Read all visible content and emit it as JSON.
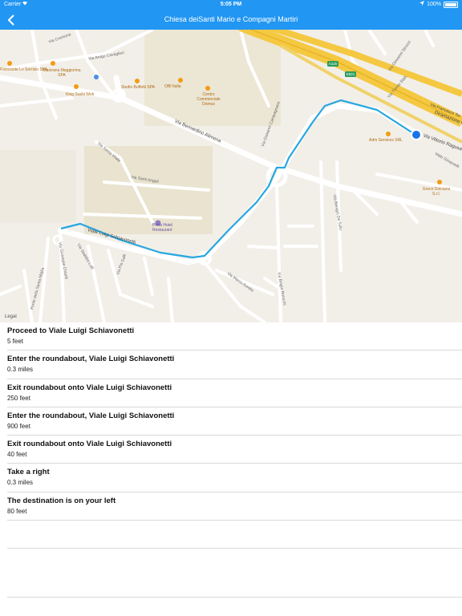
{
  "status_bar": {
    "carrier": "Carrier",
    "time": "5:05 PM",
    "battery": "100%"
  },
  "nav": {
    "title": "Chiesa deiSanti Mario e Compagni Martiri",
    "back_icon": "chevron-left-icon"
  },
  "map": {
    "legal": "Legal",
    "places": {
      "ristorante": "Ristorante Lo Sorrisio SPA",
      "maiorana": "Maiorana Maggiorina SPA",
      "studio": "Studio Buffetti SPA",
      "obi": "OBI Italia",
      "centro": "Centro Commerciale Domus",
      "sushi": "King Sushi Wok",
      "petra": "Petra Hotel Restaurant",
      "adm": "Adm Services SRL",
      "greco": "Greco Dolciaria S.r.l."
    },
    "streets": {
      "cremona": "Via Cremona",
      "arrigo": "Via Arrigo Cavaglieri",
      "bernardino": "Via Bernardino Alimena",
      "santavitale": "Via Santa Vitale",
      "santiange": "Via Santi Angeli",
      "schiavonetti": "Viale Luigi Schiavonetti",
      "campagnano": "Via Giovanni Campagnano",
      "ragusa": "Via Vittorio Ragusa",
      "francesco": "Via Francesco Tor",
      "diramazione": "Diramazione Roma",
      "benighi": "Via Benigni De Tullo",
      "trenta": "Via Trenta Stab.",
      "santamiglia": "Ponte della Santa Miglia",
      "giuseppe": "Via Giuseppe Chiariti",
      "stabilini": "Via Stabilini Lolli",
      "macro": "Via Biagio Roncchi",
      "marco": "Via Marco Aurelio",
      "dolciaria": "Viale Gioasvelli",
      "giovannistr": "Via Giovanni Strozzi",
      "via_piero": "Via Pio Galli"
    },
    "shields": {
      "a": "A1dir",
      "b": "E821"
    }
  },
  "directions": [
    {
      "instruction": "Proceed to Viale Luigi Schiavonetti",
      "distance": "5 feet"
    },
    {
      "instruction": "Enter the roundabout, Viale Luigi Schiavonetti",
      "distance": "0.3 miles"
    },
    {
      "instruction": "Exit roundabout onto Viale Luigi Schiavonetti",
      "distance": "250 feet"
    },
    {
      "instruction": "Enter the roundabout, Viale Luigi Schiavonetti",
      "distance": "900 feet"
    },
    {
      "instruction": "Exit roundabout onto Viale Luigi Schiavonetti",
      "distance": "40 feet"
    },
    {
      "instruction": "Take a right",
      "distance": "0.3 miles"
    },
    {
      "instruction": "The destination is on your left",
      "distance": "80 feet"
    }
  ],
  "colors": {
    "accent": "#2196F3",
    "route": "#27a7e0",
    "highway": "#f5c842",
    "location": "#1a73e8"
  }
}
